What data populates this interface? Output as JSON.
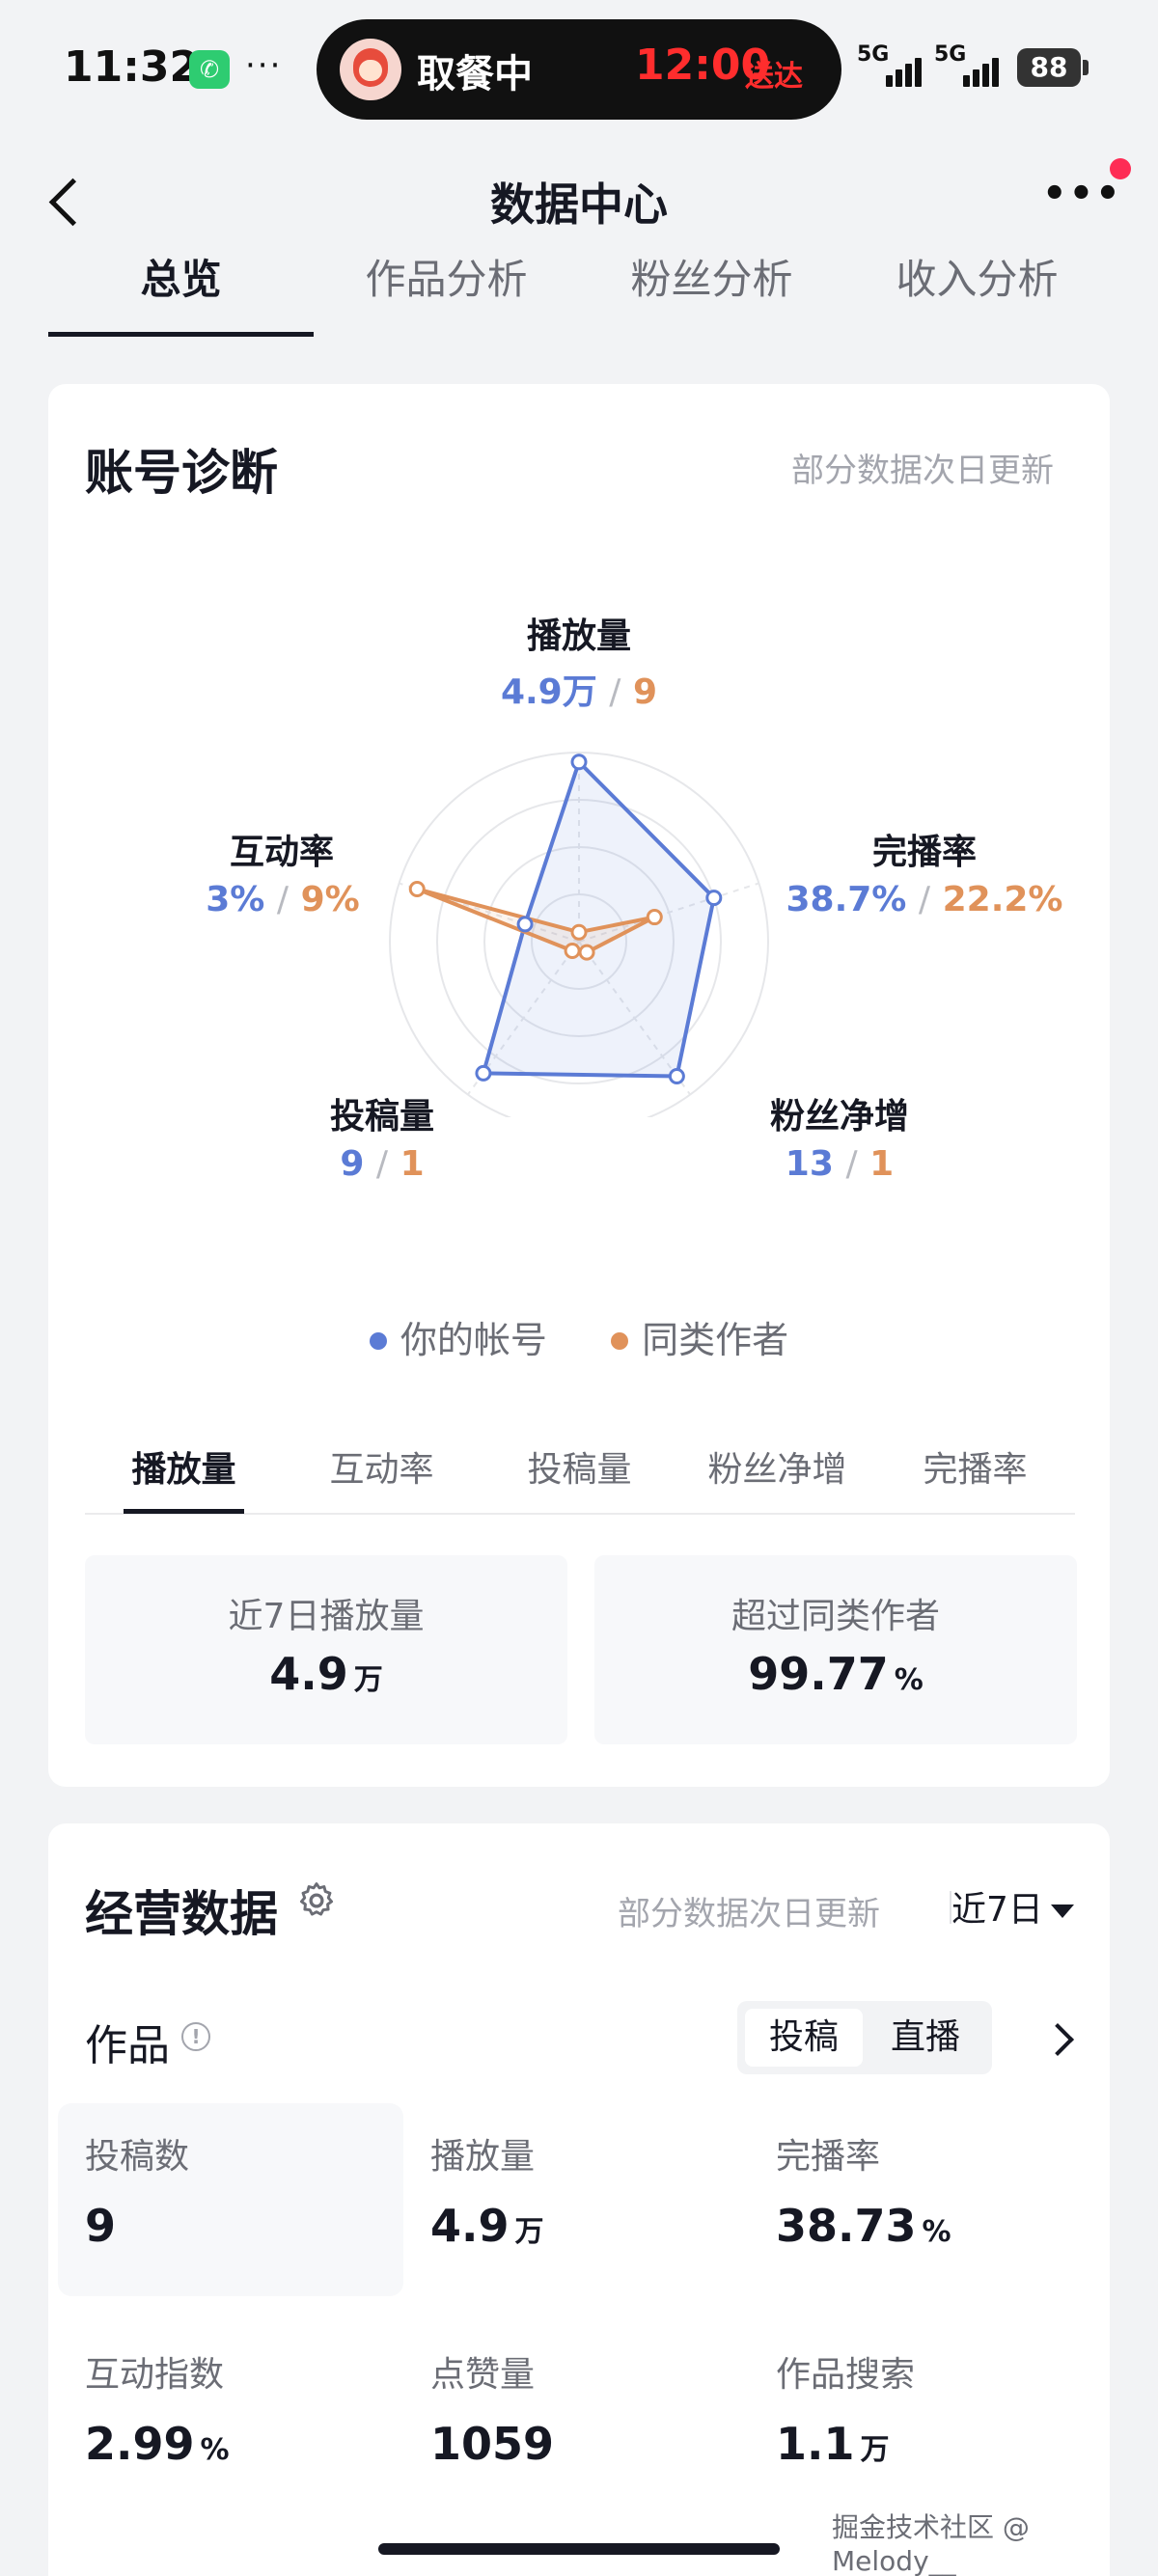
{
  "status_bar": {
    "time": "11:32",
    "island_text": "取餐中",
    "island_time": "12:00",
    "island_sub": "送达",
    "signal_1": "5G",
    "signal_2": "5G",
    "battery": "88"
  },
  "nav": {
    "title": "数据中心"
  },
  "top_tabs": [
    {
      "label": "总览",
      "active": true
    },
    {
      "label": "作品分析"
    },
    {
      "label": "粉丝分析"
    },
    {
      "label": "收入分析"
    }
  ],
  "diagnosis": {
    "title": "账号诊断",
    "note": "部分数据次日更新",
    "radar": {
      "axes": [
        {
          "label": "播放量",
          "mine": "4.9万",
          "peer": "9",
          "mine_level": 0.95,
          "peer_level": 0.05
        },
        {
          "label": "完播率",
          "mine": "38.7%",
          "peer": "22.2%",
          "mine_level": 0.75,
          "peer_level": 0.42
        },
        {
          "label": "粉丝净增",
          "mine": "13",
          "peer": "1",
          "mine_level": 0.88,
          "peer_level": 0.07
        },
        {
          "label": "投稿量",
          "mine": "9",
          "peer": "1",
          "mine_level": 0.86,
          "peer_level": 0.06
        },
        {
          "label": "互动率",
          "mine": "3%",
          "peer": "9%",
          "mine_level": 0.3,
          "peer_level": 0.9
        }
      ],
      "separator": "/"
    },
    "legend": {
      "mine": "你的帐号",
      "peer": "同类作者",
      "mine_color": "#5b7bd5",
      "peer_color": "#e0925a"
    },
    "sub_tabs": [
      {
        "label": "播放量",
        "active": true
      },
      {
        "label": "互动率"
      },
      {
        "label": "投稿量"
      },
      {
        "label": "粉丝净增"
      },
      {
        "label": "完播率"
      }
    ],
    "stats": [
      {
        "label": "近7日播放量",
        "value": "4.9",
        "unit": "万"
      },
      {
        "label": "超过同类作者",
        "value": "99.77",
        "unit": "%"
      }
    ]
  },
  "business": {
    "title": "经营数据",
    "note": "部分数据次日更新",
    "period": "近7日",
    "works_title": "作品",
    "segments": [
      "投稿",
      "直播"
    ],
    "metrics": [
      {
        "label": "投稿数",
        "value": "9",
        "unit": ""
      },
      {
        "label": "播放量",
        "value": "4.9",
        "unit": "万"
      },
      {
        "label": "完播率",
        "value": "38.73",
        "unit": "%"
      },
      {
        "label": "互动指数",
        "value": "2.99",
        "unit": "%"
      },
      {
        "label": "点赞量",
        "value": "1059",
        "unit": ""
      },
      {
        "label": "作品搜索",
        "value": "1.1",
        "unit": "万"
      }
    ]
  },
  "watermark": "掘金技术社区 @ Melody__"
}
